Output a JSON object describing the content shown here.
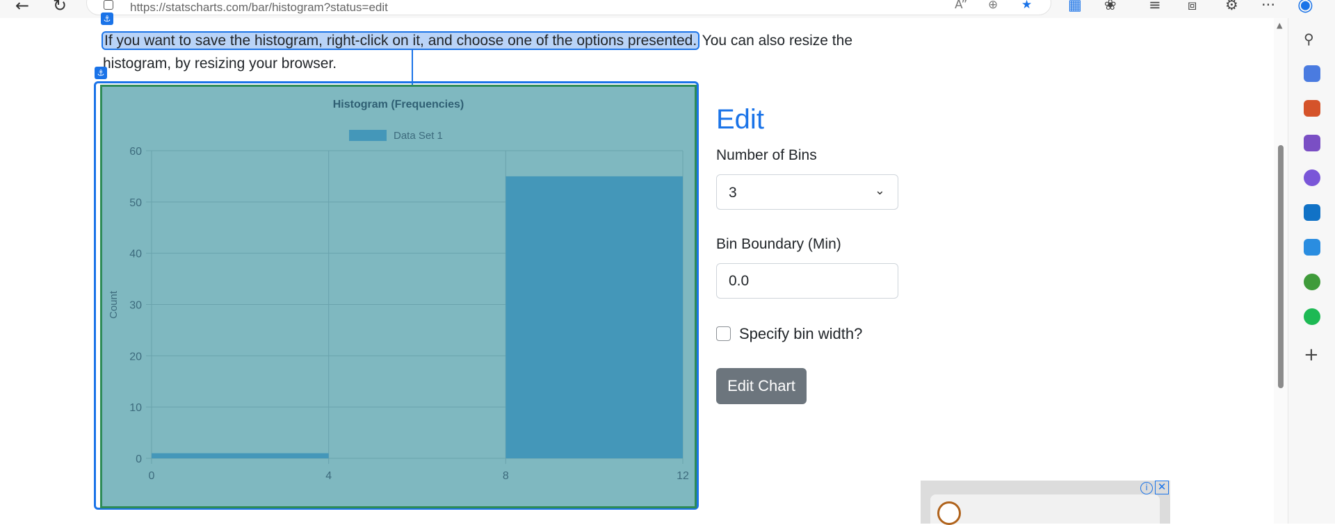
{
  "browser": {
    "url": "https://statscharts.com/bar/histogram?status=edit",
    "back_icon": "back-arrow-icon",
    "refresh_icon": "refresh-icon",
    "more_label": "···"
  },
  "intro": {
    "highlighted": "If you want to save the histogram, right-click on it, and choose one of the options presented.",
    "rest": " You can also resize the histogram, by resizing your browser.",
    "anchor_glyph": "⚓"
  },
  "chart_data": {
    "type": "bar",
    "title": "Histogram (Frequencies)",
    "legend": [
      "Data Set 1"
    ],
    "ylabel": "Count",
    "xlabel": "",
    "bins": [
      {
        "from": 0,
        "to": 4,
        "value": 1
      },
      {
        "from": 4,
        "to": 8,
        "value": 0
      },
      {
        "from": 8,
        "to": 12,
        "value": 55
      }
    ],
    "x_ticks": [
      "0",
      "4",
      "8",
      "12"
    ],
    "y_ticks": [
      "0",
      "10",
      "20",
      "30",
      "40",
      "50",
      "60"
    ],
    "ylim": [
      0,
      60
    ],
    "xlim": [
      0,
      12
    ],
    "grid": true,
    "legend_position": "top",
    "bar_color": "#4497b9",
    "background_color": "#7fb8c0"
  },
  "edit": {
    "title": "Edit",
    "bins_label": "Number of Bins",
    "bins_value": "3",
    "boundary_label": "Bin Boundary (Min)",
    "boundary_value": "0.0",
    "checkbox_label": "Specify bin width?",
    "button_label": "Edit Chart"
  },
  "ad": {
    "info_glyph": "i",
    "close_glyph": "✕"
  },
  "colors": {
    "accent": "#1a73e8",
    "button": "#6c757d"
  }
}
